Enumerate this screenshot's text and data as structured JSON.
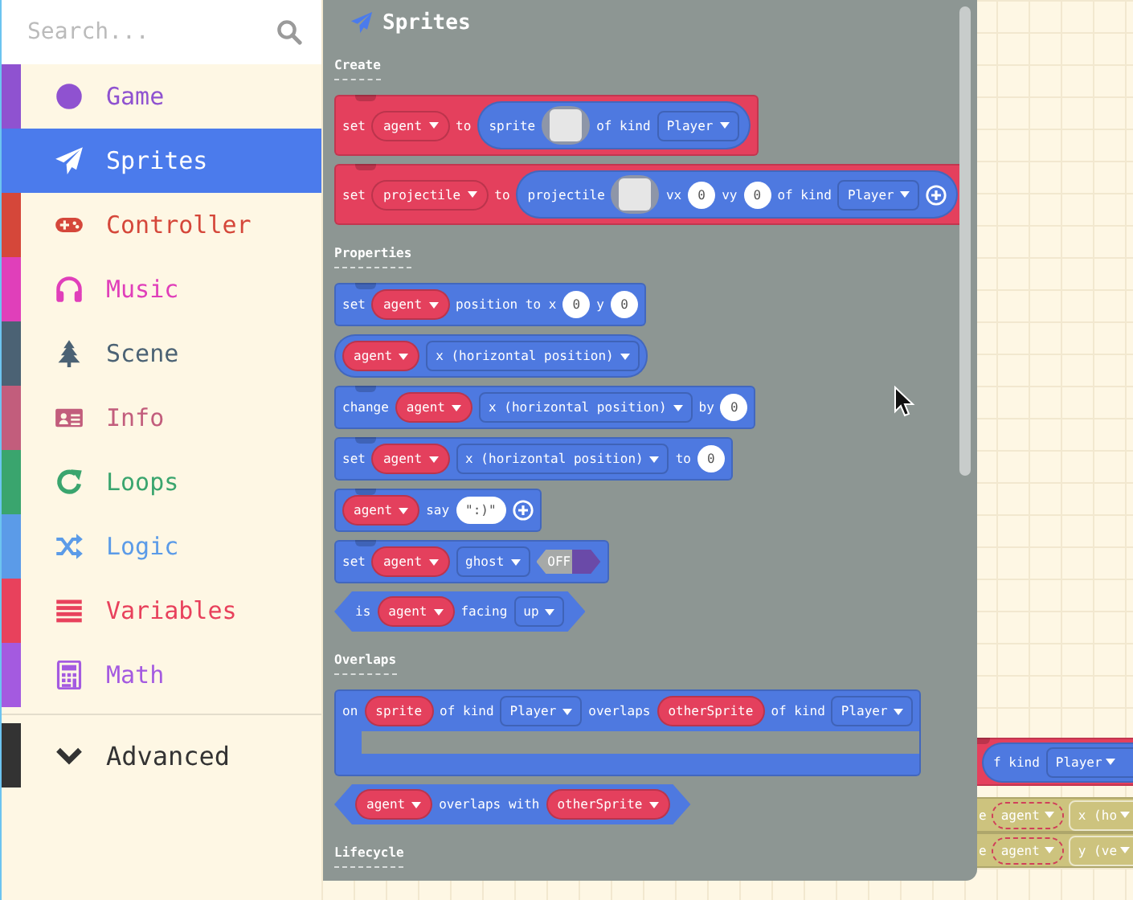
{
  "search": {
    "placeholder": "Search..."
  },
  "categories": [
    {
      "label": "Game",
      "color": "#8f52d0",
      "selected": false
    },
    {
      "label": "Sprites",
      "color": "#4b7bec",
      "selected": true
    },
    {
      "label": "Controller",
      "color": "#d5473a",
      "selected": false
    },
    {
      "label": "Music",
      "color": "#e03fba",
      "selected": false
    },
    {
      "label": "Scene",
      "color": "#4b6274",
      "selected": false
    },
    {
      "label": "Info",
      "color": "#c25d7c",
      "selected": false
    },
    {
      "label": "Loops",
      "color": "#3aa56e",
      "selected": false
    },
    {
      "label": "Logic",
      "color": "#5b9be8",
      "selected": false
    },
    {
      "label": "Variables",
      "color": "#e8415c",
      "selected": false
    },
    {
      "label": "Math",
      "color": "#a45ae0",
      "selected": false
    }
  ],
  "advanced": {
    "label": "Advanced",
    "color": "#333333"
  },
  "flyout": {
    "title": "Sprites",
    "sections": [
      {
        "heading": "Create",
        "blocks": [
          {
            "kind": "statement",
            "color": "#e4405d",
            "parts": [
              {
                "kind": "text",
                "text": "set"
              },
              {
                "kind": "variable",
                "text": "agent"
              },
              {
                "kind": "text",
                "text": "to"
              },
              {
                "kind": "reporter",
                "color": "#4e79e0",
                "parts": [
                  {
                    "kind": "text",
                    "text": "sprite"
                  },
                  {
                    "kind": "image"
                  },
                  {
                    "kind": "text",
                    "text": "of kind"
                  },
                  {
                    "kind": "dropdown",
                    "text": "Player"
                  }
                ]
              }
            ]
          },
          {
            "kind": "statement",
            "color": "#e4405d",
            "parts": [
              {
                "kind": "text",
                "text": "set"
              },
              {
                "kind": "variable",
                "text": "projectile"
              },
              {
                "kind": "text",
                "text": "to"
              },
              {
                "kind": "reporter",
                "color": "#4e79e0",
                "parts": [
                  {
                    "kind": "text",
                    "text": "projectile"
                  },
                  {
                    "kind": "image"
                  },
                  {
                    "kind": "text",
                    "text": "vx"
                  },
                  {
                    "kind": "number",
                    "text": "0"
                  },
                  {
                    "kind": "text",
                    "text": "vy"
                  },
                  {
                    "kind": "number",
                    "text": "0"
                  },
                  {
                    "kind": "text",
                    "text": "of kind"
                  },
                  {
                    "kind": "dropdown",
                    "text": "Player"
                  },
                  {
                    "kind": "plus"
                  }
                ]
              }
            ]
          }
        ]
      },
      {
        "heading": "Properties",
        "blocks": [
          {
            "kind": "statement",
            "color": "#4e79e0",
            "parts": [
              {
                "kind": "text",
                "text": "set"
              },
              {
                "kind": "variable",
                "text": "agent"
              },
              {
                "kind": "text",
                "text": "position to x"
              },
              {
                "kind": "number",
                "text": "0"
              },
              {
                "kind": "text",
                "text": "y"
              },
              {
                "kind": "number",
                "text": "0"
              }
            ]
          },
          {
            "kind": "reporter",
            "color": "#4e79e0",
            "parts": [
              {
                "kind": "variable",
                "text": "agent"
              },
              {
                "kind": "dropdown",
                "text": "x (horizontal position)"
              }
            ]
          },
          {
            "kind": "statement",
            "color": "#4e79e0",
            "parts": [
              {
                "kind": "text",
                "text": "change"
              },
              {
                "kind": "variable",
                "text": "agent"
              },
              {
                "kind": "dropdown",
                "text": "x (horizontal position)"
              },
              {
                "kind": "text",
                "text": "by"
              },
              {
                "kind": "number",
                "text": "0"
              }
            ]
          },
          {
            "kind": "statement",
            "color": "#4e79e0",
            "parts": [
              {
                "kind": "text",
                "text": "set"
              },
              {
                "kind": "variable",
                "text": "agent"
              },
              {
                "kind": "dropdown",
                "text": "x (horizontal position)"
              },
              {
                "kind": "text",
                "text": "to"
              },
              {
                "kind": "number",
                "text": "0"
              }
            ]
          },
          {
            "kind": "statement",
            "color": "#4e79e0",
            "parts": [
              {
                "kind": "variable",
                "text": "agent"
              },
              {
                "kind": "text",
                "text": "say"
              },
              {
                "kind": "string",
                "text": "\":)\""
              },
              {
                "kind": "plus"
              }
            ]
          },
          {
            "kind": "statement",
            "color": "#4e79e0",
            "parts": [
              {
                "kind": "text",
                "text": "set"
              },
              {
                "kind": "variable",
                "text": "agent"
              },
              {
                "kind": "dropdown",
                "text": "ghost"
              },
              {
                "kind": "toggle",
                "text": "OFF",
                "on": false
              }
            ]
          },
          {
            "kind": "boolean",
            "color": "#4e79e0",
            "parts": [
              {
                "kind": "text",
                "text": "is"
              },
              {
                "kind": "variable",
                "text": "agent"
              },
              {
                "kind": "text",
                "text": "facing"
              },
              {
                "kind": "dropdown",
                "text": "up"
              }
            ]
          }
        ]
      },
      {
        "heading": "Overlaps",
        "blocks": [
          {
            "kind": "hat",
            "color": "#4e79e0",
            "parts": [
              {
                "kind": "text",
                "text": "on"
              },
              {
                "kind": "param",
                "text": "sprite"
              },
              {
                "kind": "text",
                "text": "of kind"
              },
              {
                "kind": "dropdown",
                "text": "Player"
              },
              {
                "kind": "text",
                "text": "overlaps"
              },
              {
                "kind": "param",
                "text": "otherSprite"
              },
              {
                "kind": "text",
                "text": "of kind"
              },
              {
                "kind": "dropdown",
                "text": "Player"
              }
            ]
          },
          {
            "kind": "boolean",
            "color": "#4e79e0",
            "parts": [
              {
                "kind": "variable",
                "text": "agent"
              },
              {
                "kind": "text",
                "text": "overlaps with"
              },
              {
                "kind": "variable",
                "text": "otherSprite"
              }
            ]
          }
        ]
      },
      {
        "heading": "Lifecycle"
      }
    ]
  },
  "workspace": {
    "blocks": [
      {
        "kind": "statement",
        "color": "#e4405d",
        "ghost": false,
        "parts": [
          {
            "kind": "reporter",
            "color": "#4e79e0",
            "parts": [
              {
                "kind": "text",
                "text": "f kind"
              },
              {
                "kind": "dropdown",
                "text": "Player"
              }
            ]
          }
        ]
      },
      {
        "kind": "statement",
        "color": "#cdc37e",
        "ghost": true,
        "parts": [
          {
            "kind": "text",
            "text": "e"
          },
          {
            "kind": "variable",
            "text": "agent"
          },
          {
            "kind": "dropdown",
            "text": "x (ho"
          }
        ]
      },
      {
        "kind": "statement",
        "color": "#cdc37e",
        "ghost": true,
        "parts": [
          {
            "kind": "text",
            "text": "e"
          },
          {
            "kind": "variable",
            "text": "agent"
          },
          {
            "kind": "dropdown",
            "text": "y (ve"
          }
        ]
      }
    ]
  }
}
